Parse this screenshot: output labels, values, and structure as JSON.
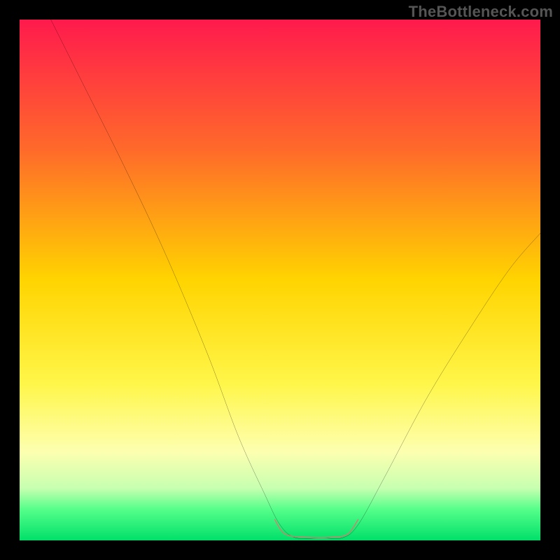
{
  "watermark": "TheBottleneck.com",
  "chart_data": {
    "type": "line",
    "title": "",
    "xlabel": "",
    "ylabel": "",
    "xlim": [
      0,
      100
    ],
    "ylim": [
      0,
      100
    ],
    "background_gradient": {
      "direction": "vertical",
      "stops": [
        {
          "offset": 0.0,
          "color": "#ff1a4d"
        },
        {
          "offset": 0.25,
          "color": "#ff6a2a"
        },
        {
          "offset": 0.5,
          "color": "#ffd400"
        },
        {
          "offset": 0.7,
          "color": "#fff64a"
        },
        {
          "offset": 0.83,
          "color": "#fdffb0"
        },
        {
          "offset": 0.9,
          "color": "#c7ffb0"
        },
        {
          "offset": 0.94,
          "color": "#55ff8a"
        },
        {
          "offset": 1.0,
          "color": "#00e06a"
        }
      ]
    },
    "series": [
      {
        "name": "bottleneck-curve",
        "color": "#000000",
        "width": 1.8,
        "points": [
          {
            "x": 6,
            "y": 100
          },
          {
            "x": 12,
            "y": 88
          },
          {
            "x": 20,
            "y": 72
          },
          {
            "x": 28,
            "y": 55
          },
          {
            "x": 36,
            "y": 36
          },
          {
            "x": 42,
            "y": 20
          },
          {
            "x": 47,
            "y": 9
          },
          {
            "x": 50,
            "y": 3
          },
          {
            "x": 53,
            "y": 0.5
          },
          {
            "x": 58,
            "y": 0.5
          },
          {
            "x": 62,
            "y": 0.5
          },
          {
            "x": 65,
            "y": 3
          },
          {
            "x": 70,
            "y": 12
          },
          {
            "x": 78,
            "y": 27
          },
          {
            "x": 86,
            "y": 40
          },
          {
            "x": 94,
            "y": 52
          },
          {
            "x": 100,
            "y": 59
          }
        ]
      }
    ],
    "highlight_segment": {
      "name": "optimal-range",
      "color": "#d87a70",
      "width": 10,
      "points": [
        {
          "x": 49,
          "y": 4
        },
        {
          "x": 51,
          "y": 1.2
        },
        {
          "x": 55,
          "y": 0.6
        },
        {
          "x": 60,
          "y": 0.6
        },
        {
          "x": 63,
          "y": 1.2
        },
        {
          "x": 65,
          "y": 4
        }
      ]
    }
  }
}
